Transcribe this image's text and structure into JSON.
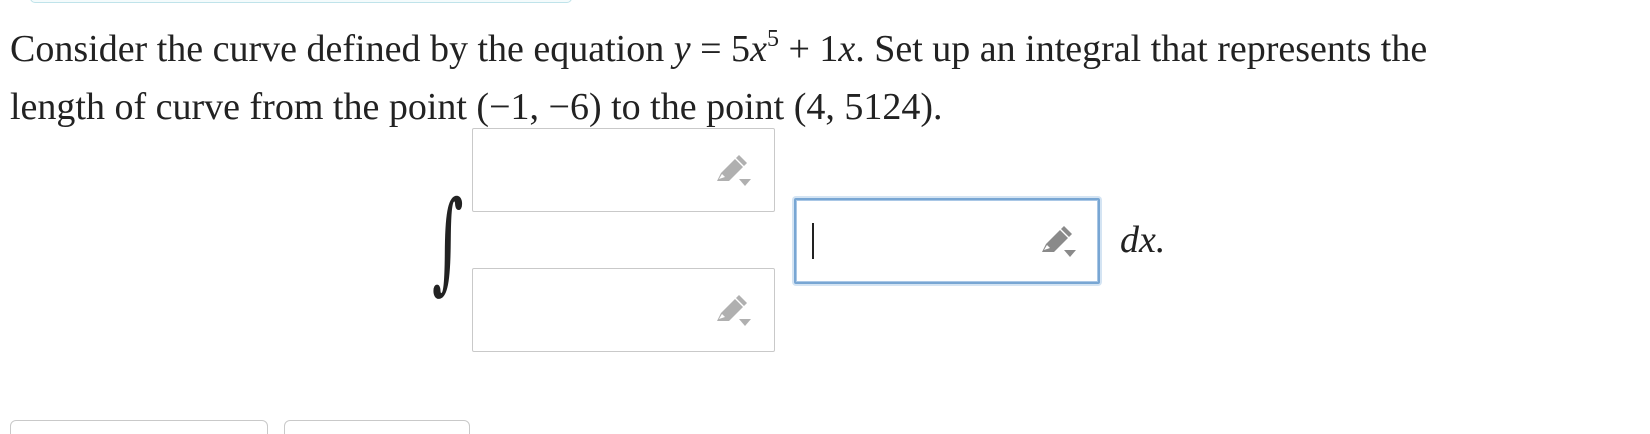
{
  "question": {
    "part1": "Consider the curve defined by the equation",
    "eq_y": "y",
    "eq_equals": " = 5",
    "eq_x": "x",
    "eq_exp": "5",
    "eq_plus": " + 1",
    "eq_x2": "x",
    "part2": ". Set up an integral that represents the",
    "line2": "length of curve from the point (−1, −6) to the point (4, 5124)."
  },
  "integral": {
    "symbol": "∫",
    "upper_limit": "",
    "lower_limit": "",
    "integrand": "",
    "differential": "dx."
  },
  "icons": {
    "edit": "pencil-dropdown-icon"
  },
  "colors": {
    "focus_border": "#78a6d3",
    "box_border": "#c9c9c9",
    "icon_gray_inactive": "#b0b0b0",
    "icon_gray_active": "#8a8a8a"
  }
}
